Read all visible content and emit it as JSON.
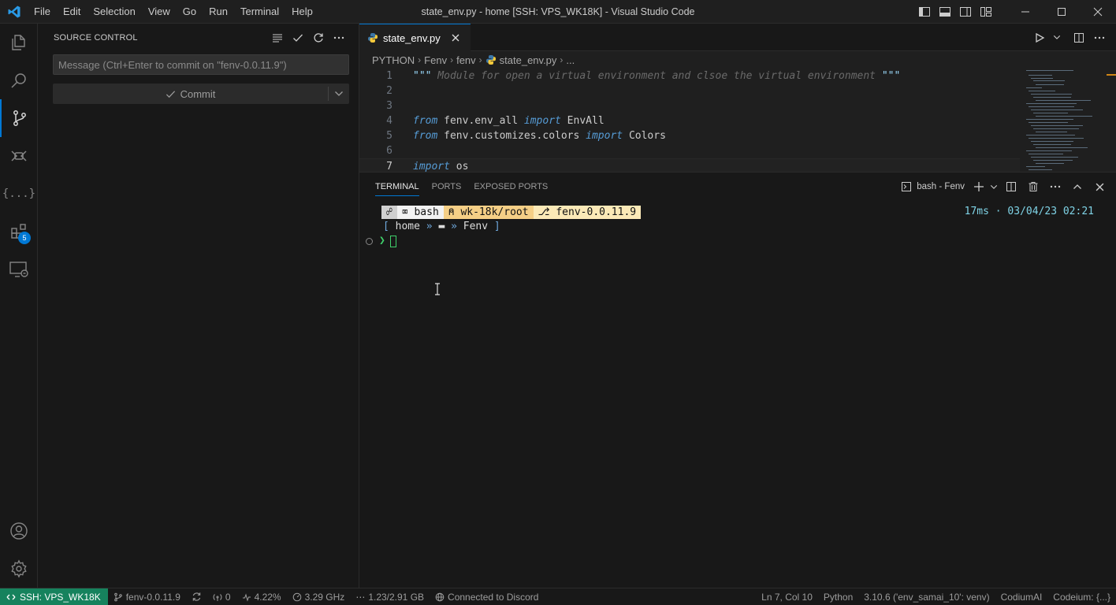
{
  "window": {
    "title": "state_env.py - home [SSH: VPS_WK18K] - Visual Studio Code",
    "menu": [
      "File",
      "Edit",
      "Selection",
      "View",
      "Go",
      "Run",
      "Terminal",
      "Help"
    ]
  },
  "colors": {
    "accent": "#0078d4",
    "remote": "#16825d",
    "keyword": "#569cd6"
  },
  "activity": {
    "extensions_badge": "5"
  },
  "sidebar": {
    "title": "SOURCE CONTROL",
    "commit_placeholder": "Message (Ctrl+Enter to commit on \"fenv-0.0.11.9\")",
    "commit_label": "Commit"
  },
  "editor": {
    "tab_label": "state_env.py",
    "breadcrumb": [
      "PYTHON",
      "Fenv",
      "fenv",
      "state_env.py",
      "..."
    ],
    "lines": [
      {
        "n": "1",
        "parts": [
          {
            "c": "doc",
            "t": "\"\"\""
          },
          {
            "c": "cm",
            "t": " Module for open a virtual environment and clsoe the virtual environment "
          },
          {
            "c": "doc",
            "t": "\"\"\""
          }
        ]
      },
      {
        "n": "2",
        "parts": []
      },
      {
        "n": "3",
        "parts": []
      },
      {
        "n": "4",
        "parts": [
          {
            "c": "kw",
            "t": "from"
          },
          {
            "c": "",
            "t": " fenv.env_all "
          },
          {
            "c": "kw",
            "t": "import"
          },
          {
            "c": "",
            "t": " EnvAll"
          }
        ]
      },
      {
        "n": "5",
        "parts": [
          {
            "c": "kw",
            "t": "from"
          },
          {
            "c": "",
            "t": " fenv.customizes.colors "
          },
          {
            "c": "kw",
            "t": "import"
          },
          {
            "c": "",
            "t": " Colors"
          }
        ]
      },
      {
        "n": "6",
        "parts": []
      },
      {
        "n": "7",
        "parts": [
          {
            "c": "kw",
            "t": "import"
          },
          {
            "c": "",
            "t": " os"
          }
        ]
      }
    ]
  },
  "panel": {
    "tabs": [
      "TERMINAL",
      "PORTS",
      "EXPOSED PORTS"
    ],
    "terminal_name": "bash - Fenv",
    "prompt": {
      "shell": "bash",
      "path": "wk-18k/root",
      "branch": "fenv-0.0.11.9",
      "timing": "17ms · 03/04/23 02:21",
      "line2_open": "[",
      "line2_home": "home",
      "line2_sep": "»",
      "line2_dir": "Fenv",
      "line2_close": "]",
      "arrow": "❯"
    }
  },
  "status": {
    "remote": "SSH: VPS_WK18K",
    "branch": "fenv-0.0.11.9",
    "ports": "0",
    "cpu": "4.22%",
    "freq": "3.29 GHz",
    "memory": "1.23/2.91 GB",
    "discord": "Connected to Discord",
    "position": "Ln 7, Col 10",
    "language": "Python",
    "interpreter": "3.10.6 ('env_samai_10': venv)",
    "codium": "CodiumAI",
    "codeium": "Codeium: {...}"
  }
}
